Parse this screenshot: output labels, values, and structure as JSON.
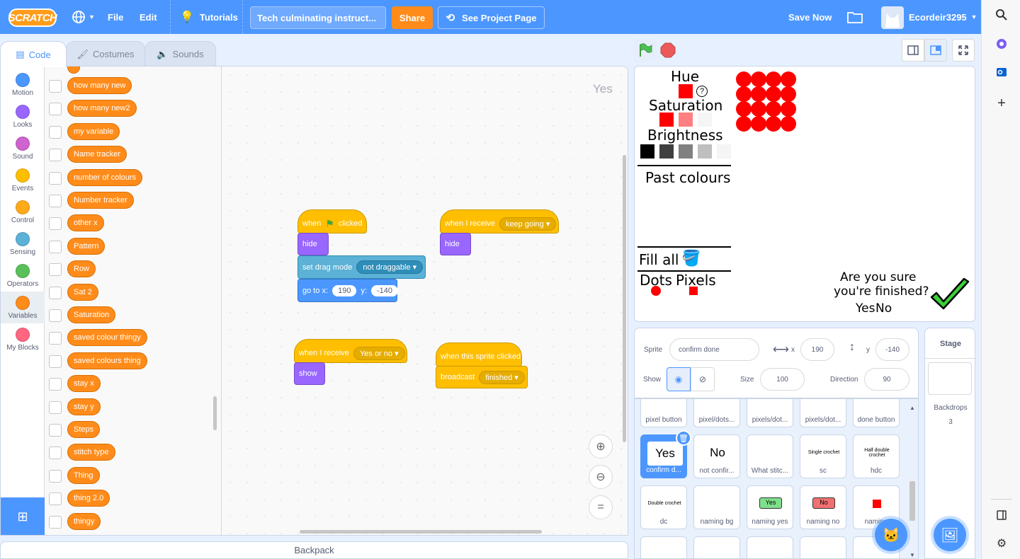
{
  "menubar": {
    "logo": "SCRATCH",
    "file": "File",
    "edit": "Edit",
    "tutorials": "Tutorials",
    "project_title": "Tech culminating instruct...",
    "share": "Share",
    "see_project": "See Project Page",
    "save_now": "Save Now",
    "username": "Ecordeir3295"
  },
  "tabs": {
    "code": "Code",
    "costumes": "Costumes",
    "sounds": "Sounds"
  },
  "categories": [
    {
      "label": "Motion",
      "color": "#4c97ff"
    },
    {
      "label": "Looks",
      "color": "#9966ff"
    },
    {
      "label": "Sound",
      "color": "#cf63cf"
    },
    {
      "label": "Events",
      "color": "#ffbf00"
    },
    {
      "label": "Control",
      "color": "#ffab19"
    },
    {
      "label": "Sensing",
      "color": "#5cb1d6"
    },
    {
      "label": "Operators",
      "color": "#59c059"
    },
    {
      "label": "Variables",
      "color": "#ff8c1a"
    },
    {
      "label": "My Blocks",
      "color": "#ff6680"
    }
  ],
  "variables": [
    "how many new",
    "how many new2",
    "my variable",
    "Name tracker",
    "number of colours",
    "Number tracker",
    "other x",
    "Pattern",
    "Row",
    "Sat 2",
    "Saturation",
    "saved colour thingy",
    "saved colours thing",
    "stay x",
    "stay y",
    "Steps",
    "stitch type",
    "Thing",
    "thing 2.0",
    "thingy"
  ],
  "workspace": {
    "sprite_watermark": "Yes",
    "s1": {
      "when": "when",
      "clicked": "clicked",
      "hide": "hide",
      "drag": "set drag mode",
      "drag_val": "not draggable",
      "goto": "go to x:",
      "x": "190",
      "y_lbl": "y:",
      "y": "-140"
    },
    "s2": {
      "recv": "when I receive",
      "msg": "keep going",
      "hide": "hide"
    },
    "s3": {
      "recv": "when I receive",
      "msg": "Yes or no",
      "show": "show"
    },
    "s4": {
      "clicked": "when this sprite clicked",
      "broadcast": "broadcast",
      "msg": "finished"
    }
  },
  "backpack": "Backpack",
  "stage": {
    "hue": "Hue",
    "saturation": "Saturation",
    "brightness": "Brightness",
    "past": "Past colours",
    "fill_all": "Fill all",
    "dots": "Dots",
    "pixels": "Pixels",
    "confirm_q1": "Are you sure",
    "confirm_q2": "you're finished?",
    "yes": "Yes",
    "no": "No",
    "question_mark": "?"
  },
  "sprite_info": {
    "sprite_lbl": "Sprite",
    "sprite_name": "confirm done",
    "x_lbl": "x",
    "x": "190",
    "y_lbl": "y",
    "y": "-140",
    "show_lbl": "Show",
    "size_lbl": "Size",
    "size": "100",
    "dir_lbl": "Direction",
    "dir": "90"
  },
  "sprites": [
    {
      "name": "pixel button",
      "thumb": ""
    },
    {
      "name": "pixel/dots...",
      "thumb": ""
    },
    {
      "name": "pixels/dot...",
      "thumb": ""
    },
    {
      "name": "pixels/dot...",
      "thumb": ""
    },
    {
      "name": "done button",
      "thumb": ""
    },
    {
      "name": "confirm d...",
      "thumb": "Yes"
    },
    {
      "name": "not confir...",
      "thumb": "No"
    },
    {
      "name": "What stitc...",
      "thumb": ""
    },
    {
      "name": "sc",
      "thumb": "Single crochet"
    },
    {
      "name": "hdc",
      "thumb": "Half double crochet"
    },
    {
      "name": "dc",
      "thumb": "Double crochet"
    },
    {
      "name": "naming bg",
      "thumb": ""
    },
    {
      "name": "naming yes",
      "thumb": "Yes"
    },
    {
      "name": "naming no",
      "thumb": "No"
    },
    {
      "name": "naming",
      "thumb": ""
    }
  ],
  "stage_pane": {
    "title": "Stage",
    "backdrops": "Backdrops",
    "count": "3"
  },
  "colors": {
    "accent": "#4c97ff",
    "variables": "#ff8c1a",
    "events": "#ffbf00",
    "looks": "#9966ff",
    "sensing": "#5cb1d6",
    "motion": "#4c97ff",
    "stage_red": "#ff0000"
  }
}
